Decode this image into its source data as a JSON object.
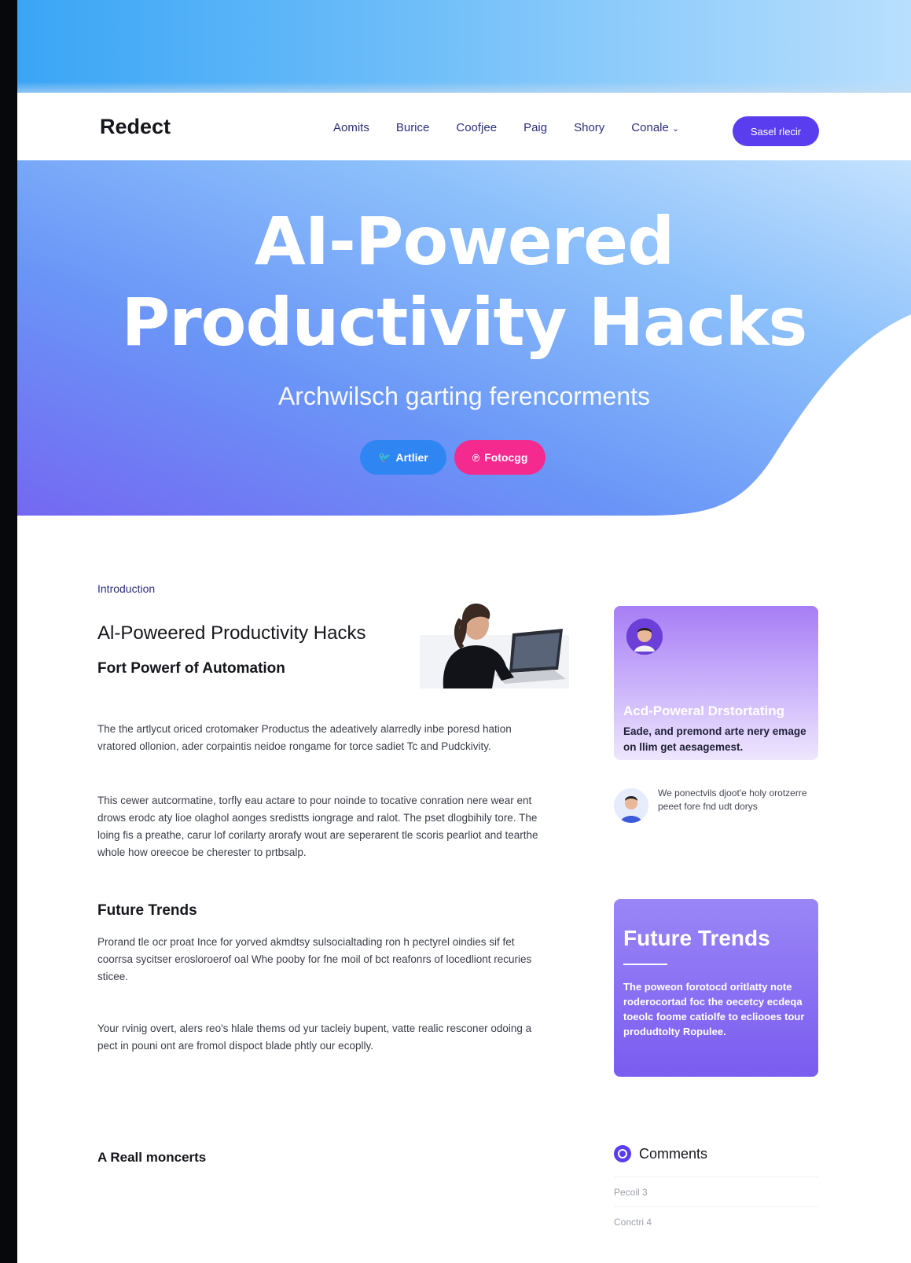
{
  "brand": "Redect",
  "nav": {
    "links": [
      "Aomits",
      "Burice",
      "Coofjee",
      "Paig",
      "Shory",
      "Conale"
    ],
    "cta": "Sasel rlecir"
  },
  "hero": {
    "title_line1": "AI-Powered",
    "title_line2": "Productivity Hacks",
    "subtitle": "Archwilsch garting ferencorments",
    "btn_primary": "Artlier",
    "btn_secondary": "Fotocgg"
  },
  "article": {
    "label": "Introduction",
    "title": "Al-Poweered Productivity Hacks",
    "subtitle": "Fort Powerf of Automation",
    "para1": "The the artlycut oriced crotomaker Productus the adeatively alarredly inbe poresd hation vratored ollonion, ader corpaintis neidoe rongame for torce sadiet Tc and Pudckivity.",
    "para2": "This cewer autcormatine, torfly eau actare to pour noinde to tocative conration nere wear ent drows erodc aty lioe olaghol aonges sredistts iongrage and ralot. The pset dlogbihily tore. The loing fis a preathe, carur lof corilarty arorafy wout are seperarent tle scoris pearliot and tearthe whole how oreecoe be cherester to prtbsalp.",
    "future_head": "Future Trends",
    "para3": "Prorand tle ocr proat Ince for yorved akmdtsy sulsocialtading ron h pectyrel oindies sif fet coorrsa sycitser erosloroerof oal Whe pooby for fne moil of bct reafonrs of locedliont recuries sticee.",
    "para4": "Your rvinig overt, alers reo's hlale thems od yur tacleiy bupent, vatte realic resconer odoing a pect in pouni ont are fromol dispoct blade phtly our ecoplly.",
    "bottom_head": "A Reall moncerts"
  },
  "sidebar": {
    "card1_title": "Acd-Poweral Drstortating",
    "card1_text": "Eade, and premond arte nery emage on llim get aesagemest.",
    "comment_text": "We ponectvils djoot'e holy orotzerre peeet fore fnd udt dorys",
    "card2_title": "Future Trends",
    "card2_text": "The poweon forotocd oritlatty note roderocortad foc the oecetcy ecdeqa toeolc foome catiolfe to ecliooes tour produdtolty Ropulee.",
    "comments_title": "Comments",
    "comments_items": [
      "Pecoil 3",
      "Conctri 4"
    ]
  },
  "colors": {
    "accent": "#5b3df0",
    "pink": "#f42a8e",
    "blue": "#2f86f3"
  }
}
